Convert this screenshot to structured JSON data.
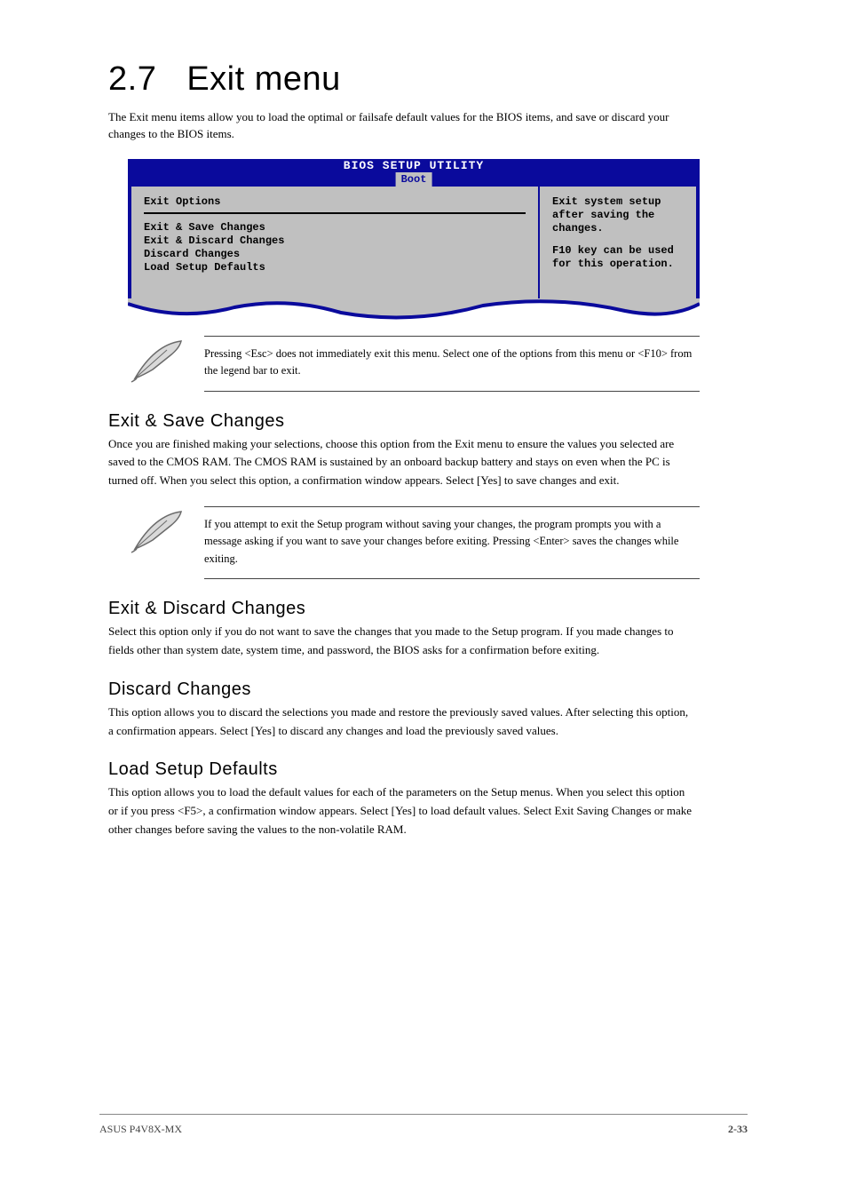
{
  "heading": {
    "number": "2.7",
    "title": "Exit menu"
  },
  "intro": "The Exit menu items allow you to load the optimal or failsafe default values for the BIOS items, and save or discard your changes to the BIOS items.",
  "bios": {
    "utility_title": "BIOS SETUP UTILITY",
    "active_tab": "Boot",
    "left": {
      "section": "Exit Options",
      "items": [
        "Exit & Save Changes",
        "Exit & Discard Changes",
        "Discard Changes",
        "",
        "Load Setup Defaults"
      ]
    },
    "right": {
      "help1": "Exit system setup after saving the changes.",
      "help2": "F10 key can be used for this operation."
    }
  },
  "note1": "Pressing <Esc> does not immediately exit this menu. Select one of the options from this menu or <F10> from the legend bar to exit.",
  "sections": [
    {
      "title": "Exit & Save Changes",
      "body": "Once you are finished making your selections, choose this option from the Exit menu to ensure the values you selected are saved to the CMOS RAM. The CMOS RAM is sustained by an onboard backup battery and stays on even when the PC is turned off. When you select this option, a confirmation window appears. Select [Yes] to save changes and exit."
    }
  ],
  "note2": "If you attempt to exit the Setup program without saving your changes, the program prompts you with a message asking if you want to save your changes before exiting. Pressing <Enter> saves the changes while exiting.",
  "sections2": [
    {
      "title": "Exit & Discard Changes",
      "body": "Select this option only if you do not want to save the changes that you made to the Setup program. If you made changes to fields other than system date, system time, and password, the BIOS asks for a confirmation before exiting."
    },
    {
      "title": "Discard Changes",
      "body": "This option allows you to discard the selections you made and restore the previously saved values. After selecting this option, a confirmation appears. Select [Yes] to discard any changes and load the previously saved values."
    },
    {
      "title": "Load Setup Defaults",
      "body": "This option allows you to load the default values for each of the parameters on the Setup menus. When you select this option or if you press <F5>, a confirmation window appears. Select [Yes] to load default values. Select Exit Saving Changes or make other changes before saving the values to the non-volatile RAM."
    }
  ],
  "footer": {
    "left": "ASUS P4V8X-MX",
    "right": "2-33"
  }
}
